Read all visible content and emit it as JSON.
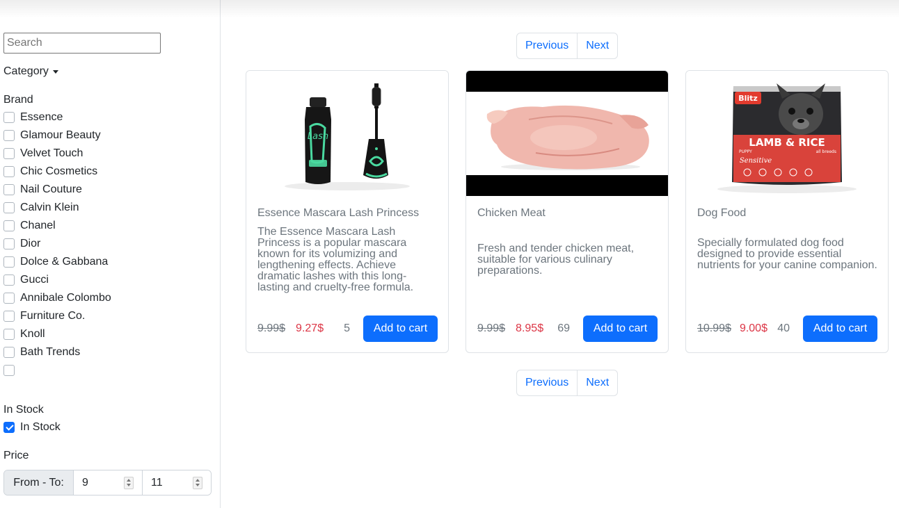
{
  "sidebar": {
    "search_placeholder": "Search",
    "category_label": "Category",
    "brand_heading": "Brand",
    "brands": [
      {
        "label": "Essence",
        "checked": false
      },
      {
        "label": "Glamour Beauty",
        "checked": false
      },
      {
        "label": "Velvet Touch",
        "checked": false
      },
      {
        "label": "Chic Cosmetics",
        "checked": false
      },
      {
        "label": "Nail Couture",
        "checked": false
      },
      {
        "label": "Calvin Klein",
        "checked": false
      },
      {
        "label": "Chanel",
        "checked": false
      },
      {
        "label": "Dior",
        "checked": false
      },
      {
        "label": "Dolce & Gabbana",
        "checked": false
      },
      {
        "label": "Gucci",
        "checked": false
      },
      {
        "label": "Annibale Colombo",
        "checked": false
      },
      {
        "label": "Furniture Co.",
        "checked": false
      },
      {
        "label": "Knoll",
        "checked": false
      },
      {
        "label": "Bath Trends",
        "checked": false
      },
      {
        "label": "",
        "checked": false
      }
    ],
    "stock_heading": "In Stock",
    "stock_label": "In Stock",
    "stock_checked": true,
    "price_heading": "Price",
    "price_label": "From - To:",
    "price_from": "9",
    "price_to": "11"
  },
  "pagination": {
    "previous_label": "Previous",
    "next_label": "Next"
  },
  "products": [
    {
      "title": "Essence Mascara Lash Princess",
      "description": "The Essence Mascara Lash Princess is a popular mascara known for its volumizing and lengthening effects. Achieve dramatic lashes with this long-lasting and cruelty-free formula.",
      "old_price": "9.99$",
      "new_price": "9.27$",
      "stock": "5",
      "cart_label": "Add to cart",
      "image_icon": "mascara-image"
    },
    {
      "title": "Chicken Meat",
      "description": "Fresh and tender chicken meat, suitable for various culinary preparations.",
      "old_price": "9.99$",
      "new_price": "8.95$",
      "stock": "69",
      "cart_label": "Add to cart",
      "image_icon": "chicken-image"
    },
    {
      "title": "Dog Food",
      "description": "Specially formulated dog food designed to provide essential nutrients for your canine companion.",
      "old_price": "10.99$",
      "new_price": "9.00$",
      "stock": "40",
      "cart_label": "Add to cart",
      "image_icon": "dog-food-image",
      "image_text": {
        "brand": "Blitz",
        "line1": "LAMB & RICE",
        "line2": "PUPPY",
        "line3": "all breeds",
        "line4": "Sensitive"
      }
    }
  ],
  "colors": {
    "primary": "#0d6efd",
    "sale_price": "#dc3545",
    "muted": "#6c757d"
  }
}
